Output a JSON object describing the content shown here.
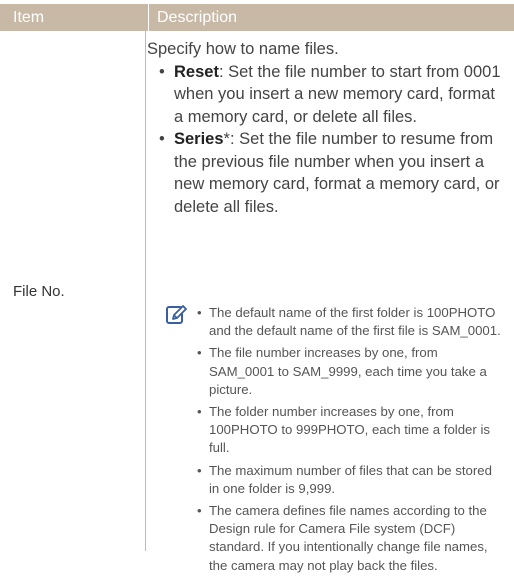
{
  "table": {
    "header_item": "Item",
    "header_description": "Description",
    "row_item": "File No.",
    "intro": "Specify how to name files.",
    "bullets": [
      {
        "term": "Reset",
        "text": ": Set the file number to start from 0001 when you insert a new memory card, format a memory card, or delete all files."
      },
      {
        "term": "Series",
        "text": "*: Set the file number to resume from the previous file number when you insert a new memory card, format a memory card, or delete all files."
      }
    ],
    "notes": [
      "The default name of the first folder is 100PHOTO and the default name of the first file is SAM_0001.",
      "The file number increases by one, from SAM_0001 to SAM_9999, each time you take a picture.",
      "The folder number increases by one, from 100PHOTO to 999PHOTO, each time a folder is full.",
      "The maximum number of files that can be stored in one folder is 9,999.",
      "The camera defines file names according to the Design rule for Camera File system (DCF) standard. If you intentionally change file names, the camera may not play back the files."
    ]
  },
  "colors": {
    "header_bg": "#c7b9a6",
    "note_icon": "#3a5fa0"
  },
  "icons": {
    "note": "note-pencil-icon"
  }
}
